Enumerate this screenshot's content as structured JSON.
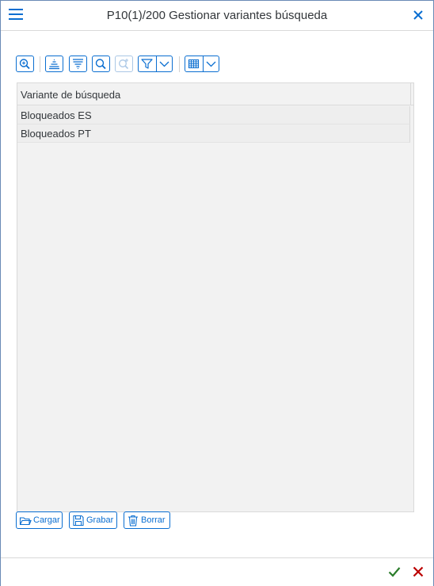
{
  "window": {
    "title": "P10(1)/200 Gestionar variantes búsqueda"
  },
  "icons": {
    "menu": "hamburger-menu-icon",
    "close": "close-icon",
    "ok": "checkmark-icon",
    "cancel": "cancel-x-icon"
  },
  "toolbar": {
    "buttons": [
      {
        "name": "details-zoom-button",
        "icon": "zoom-details-icon"
      },
      {
        "name": "sort-ascending-button",
        "icon": "sort-ascending-icon"
      },
      {
        "name": "sort-descending-button",
        "icon": "sort-descending-icon"
      },
      {
        "name": "find-button",
        "icon": "search-icon"
      },
      {
        "name": "find-next-button",
        "icon": "search-next-icon",
        "disabled": true
      },
      {
        "name": "filter-button",
        "icon": "filter-icon"
      },
      {
        "name": "layout-button",
        "icon": "table-grid-icon"
      }
    ]
  },
  "grid": {
    "column_header": "Variante de búsqueda",
    "rows": [
      {
        "label": "Bloqueados ES"
      },
      {
        "label": "Bloqueados PT"
      }
    ]
  },
  "actions": {
    "load_label": "Cargar",
    "save_label": "Grabar",
    "delete_label": "Borrar"
  },
  "colors": {
    "accent": "#0a6ed1",
    "ok_green": "#2b7d2b",
    "cancel_red": "#bb0000",
    "grid_background": "#f2f2f2"
  }
}
